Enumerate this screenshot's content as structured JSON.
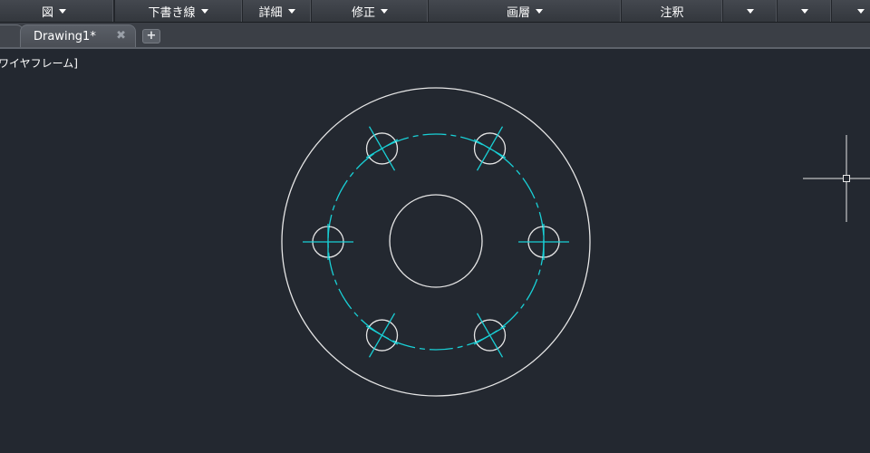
{
  "ribbon": {
    "panels": [
      {
        "label": "図",
        "has_dropdown": true
      },
      {
        "label": "",
        "has_dropdown": false
      },
      {
        "label": "下書き線",
        "has_dropdown": true
      },
      {
        "label": "詳細",
        "has_dropdown": true
      },
      {
        "label": "修正",
        "has_dropdown": true
      },
      {
        "label": "画層",
        "has_dropdown": true
      },
      {
        "label": "注釈",
        "has_dropdown": false
      },
      {
        "label": "",
        "has_dropdown": true
      },
      {
        "label": "",
        "has_dropdown": true
      },
      {
        "label": "",
        "has_dropdown": true
      }
    ]
  },
  "tabs": {
    "active_title": "Drawing1*",
    "close_glyph": "✖",
    "add_glyph": "+"
  },
  "viewport": {
    "label": "ワイヤフレーム]"
  },
  "colors": {
    "background": "#232830",
    "geometry": "#e6e6e6",
    "centerline": "#19d0d6",
    "ribbon_text": "#ffffff"
  }
}
